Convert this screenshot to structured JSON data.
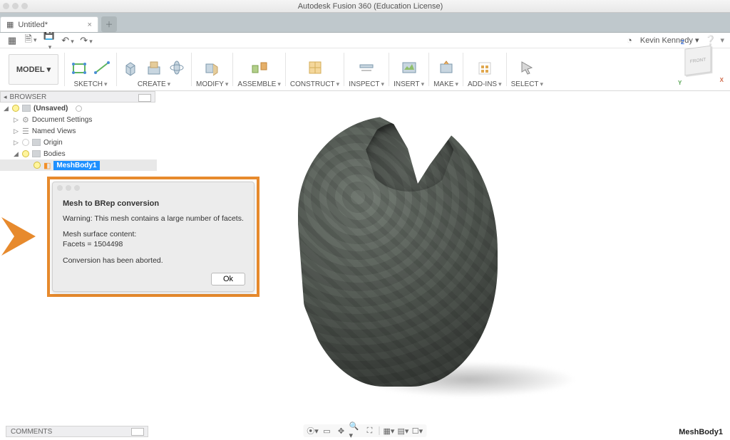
{
  "app": {
    "title": "Autodesk Fusion 360 (Education License)"
  },
  "tab": {
    "title": "Untitled*"
  },
  "user": {
    "name": "Kevin Kennedy"
  },
  "ribbon": {
    "model_btn": "MODEL",
    "groups": {
      "sketch": "SKETCH",
      "create": "CREATE",
      "modify": "MODIFY",
      "assemble": "ASSEMBLE",
      "construct": "CONSTRUCT",
      "inspect": "INSPECT",
      "insert": "INSERT",
      "make": "MAKE",
      "addins": "ADD-INS",
      "select": "SELECT"
    }
  },
  "browser": {
    "header": "BROWSER",
    "root": "(Unsaved)",
    "items": {
      "docset": "Document Settings",
      "named": "Named Views",
      "origin": "Origin",
      "bodies": "Bodies",
      "mesh": "MeshBody1"
    }
  },
  "viewcube": {
    "face": "FRONT"
  },
  "dialog": {
    "title": "Mesh to BRep conversion",
    "warn": "Warning: This mesh contains a large number of facets.",
    "surface_label": "Mesh surface content:",
    "facets_line": "Facets = 1504498",
    "aborted": "Conversion has been aborted.",
    "ok": "Ok",
    "facets_count": 1504498
  },
  "comments": {
    "label": "COMMENTS"
  },
  "status": {
    "selected": "MeshBody1"
  }
}
